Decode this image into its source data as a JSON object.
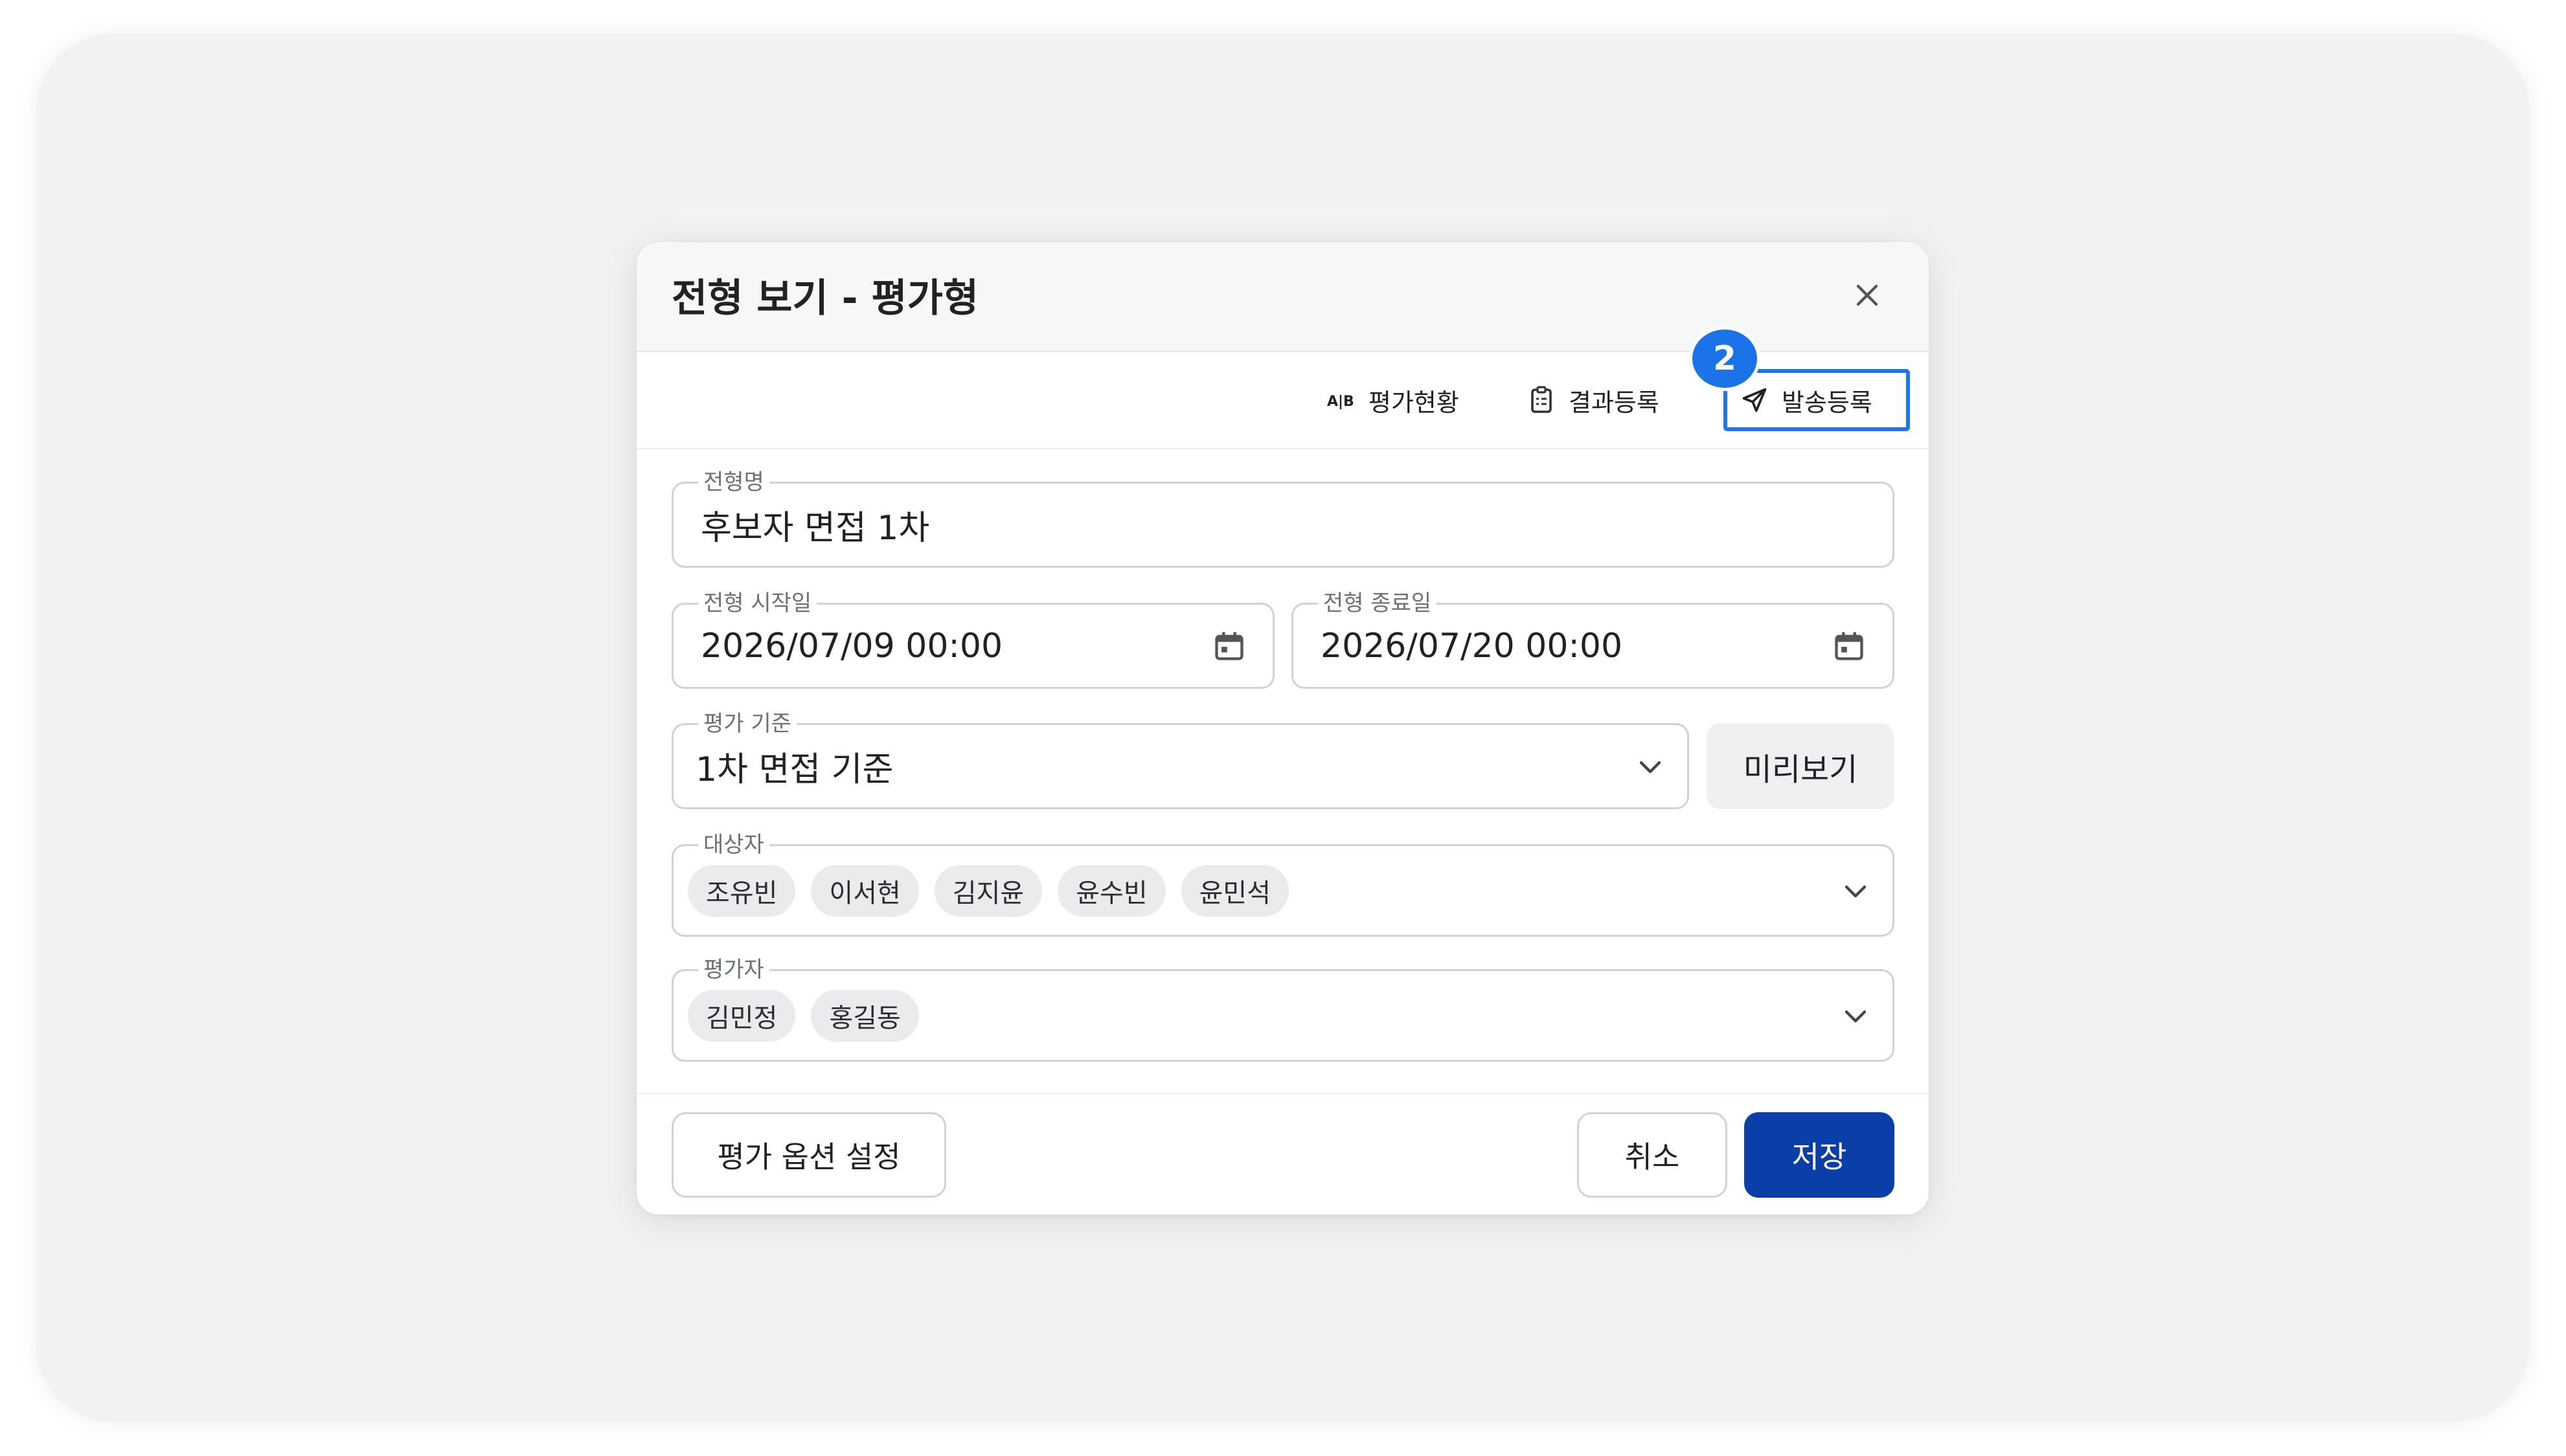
{
  "dialog": {
    "title": "전형 보기 - 평가형",
    "close_icon": "close-icon"
  },
  "toolbar": {
    "items": [
      {
        "label": "평가현황",
        "icon": "ab-icon"
      },
      {
        "label": "결과등록",
        "icon": "clipboard-icon"
      },
      {
        "label": "발송등록",
        "icon": "send-icon",
        "highlighted": true
      }
    ],
    "step_badge": "2",
    "highlight_color": "#1976f2",
    "badge_color": "#1a73e8"
  },
  "form": {
    "name": {
      "label": "전형명",
      "value": "후보자 면접 1차"
    },
    "start_date": {
      "label": "전형 시작일",
      "value": "2026/07/09 00:00",
      "icon": "calendar-icon"
    },
    "end_date": {
      "label": "전형 종료일",
      "value": "2026/07/20 00:00",
      "icon": "calendar-icon"
    },
    "criteria": {
      "label": "평가 기준",
      "value": "1차 면접 기준",
      "icon": "chevron-down-icon"
    },
    "preview_button": "미리보기",
    "targets": {
      "label": "대상자",
      "chips": [
        "조유빈",
        "이서현",
        "김지윤",
        "윤수빈",
        "윤민석"
      ],
      "icon": "chevron-down-icon"
    },
    "evaluators": {
      "label": "평가자",
      "chips": [
        "김민정",
        "홍길동"
      ],
      "icon": "chevron-down-icon"
    }
  },
  "footer": {
    "options_button": "평가 옵션 설정",
    "cancel_button": "취소",
    "save_button": "저장",
    "primary_color": "#0a3ea8"
  }
}
